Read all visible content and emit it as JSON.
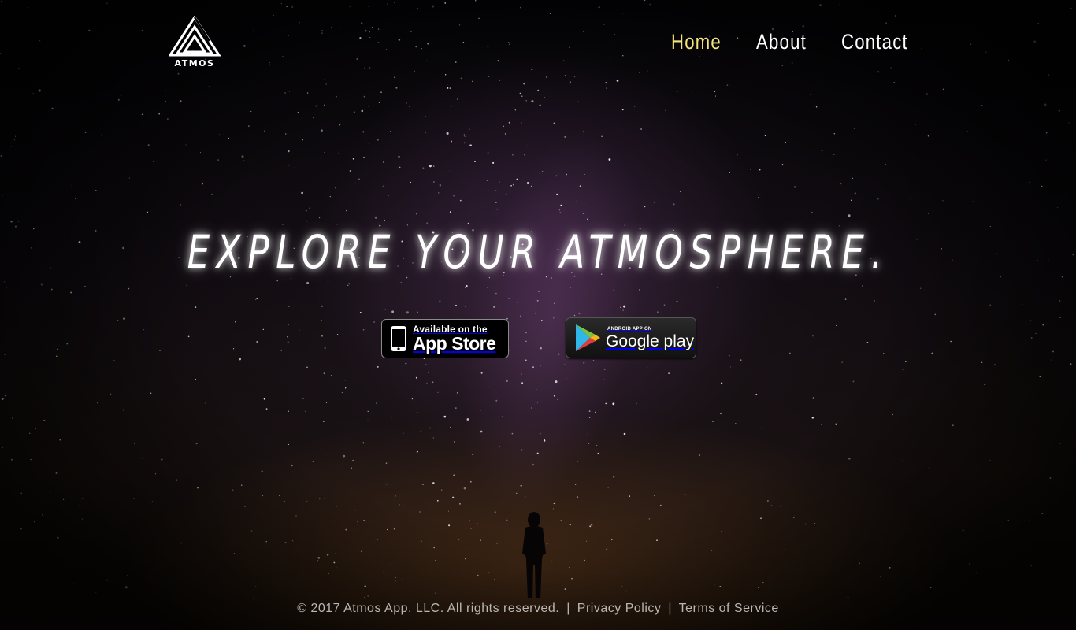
{
  "brand": {
    "logo_text": "ATMOS",
    "icon": "atmos-triangle-logo-icon"
  },
  "nav": {
    "items": [
      {
        "label": "Home",
        "active": true
      },
      {
        "label": "About",
        "active": false
      },
      {
        "label": "Contact",
        "active": false
      }
    ],
    "active_color": "#f4e67a",
    "color": "#ffffff"
  },
  "hero": {
    "title": "EXPLORE YOUR ATMOSPHERE."
  },
  "downloads": {
    "app_store": {
      "small_text": "Available on the",
      "big_text": "App Store",
      "icon": "iphone-icon"
    },
    "google_play": {
      "small_text": "ANDROID APP ON",
      "big_text": "Google play",
      "icon": "google-play-icon"
    }
  },
  "footer": {
    "copyright": "© 2017 Atmos App, LLC. All rights reserved.",
    "separator": "|",
    "privacy_link": "Privacy Policy",
    "terms_link": "Terms of Service"
  }
}
